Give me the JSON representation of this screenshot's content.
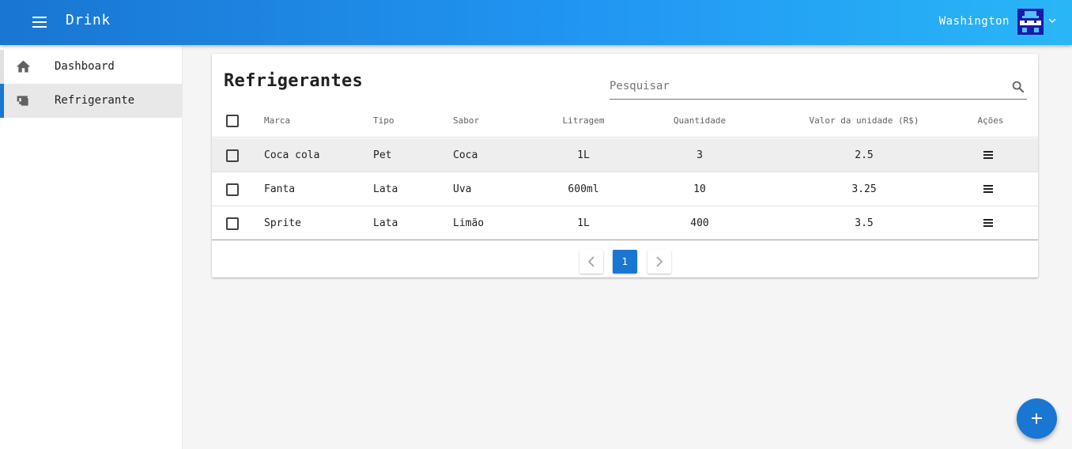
{
  "appbar": {
    "title": "Drink",
    "user_name": "Washington",
    "icons": {
      "menu": "menu-icon",
      "avatar": "pixel-avatar",
      "chevron": "chevron-down-icon"
    }
  },
  "sidebar": {
    "items": [
      {
        "label": "Dashboard",
        "icon": "home-icon",
        "active": false
      },
      {
        "label": "Refrigerante",
        "icon": "bottle-icon",
        "active": true
      }
    ]
  },
  "card": {
    "title": "Refrigerantes",
    "search_placeholder": "Pesquisar"
  },
  "table": {
    "headers": [
      "Marca",
      "Tipo",
      "Sabor",
      "Litragem",
      "Quantidade",
      "Valor da unidade (R$)",
      "Ações"
    ],
    "rows": [
      {
        "marca": "Coca cola",
        "tipo": "Pet",
        "sabor": "Coca",
        "litragem": "1L",
        "quantidade": "3",
        "valor": "2.5"
      },
      {
        "marca": "Fanta",
        "tipo": "Lata",
        "sabor": "Uva",
        "litragem": "600ml",
        "quantidade": "10",
        "valor": "3.25"
      },
      {
        "marca": "Sprite",
        "tipo": "Lata",
        "sabor": "Limão",
        "litragem": "1L",
        "quantidade": "400",
        "valor": "3.5"
      }
    ]
  },
  "pagination": {
    "current_page": "1"
  },
  "colors": {
    "primary": "#1976d2",
    "appbar_end": "#29b6f6",
    "row_hover": "#eeeeee"
  }
}
